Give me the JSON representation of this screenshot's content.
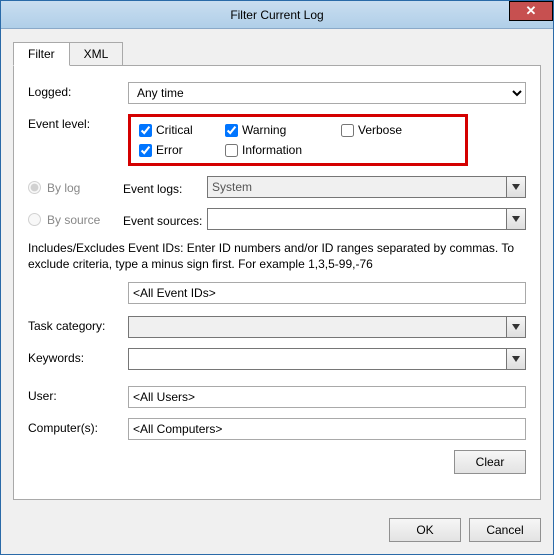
{
  "window": {
    "title": "Filter Current Log",
    "close_glyph": "✕"
  },
  "tabs": [
    {
      "label": "Filter",
      "active": true
    },
    {
      "label": "XML",
      "active": false
    }
  ],
  "labels": {
    "logged": "Logged:",
    "event_level": "Event level:",
    "by_log": "By log",
    "by_source": "By source",
    "event_logs": "Event logs:",
    "event_sources": "Event sources:",
    "task_category": "Task category:",
    "keywords": "Keywords:",
    "user": "User:",
    "computers": "Computer(s):"
  },
  "logged_value": "Any time",
  "levels": {
    "critical": {
      "label": "Critical",
      "checked": true
    },
    "warning": {
      "label": "Warning",
      "checked": true
    },
    "verbose": {
      "label": "Verbose",
      "checked": false
    },
    "error": {
      "label": "Error",
      "checked": true
    },
    "information": {
      "label": "Information",
      "checked": false
    }
  },
  "event_logs_value": "System",
  "event_sources_value": "",
  "description": "Includes/Excludes Event IDs: Enter ID numbers and/or ID ranges separated by commas. To exclude criteria, type a minus sign first. For example 1,3,5-99,-76",
  "event_ids_value": "<All Event IDs>",
  "task_category_value": "",
  "keywords_value": "",
  "user_value": "<All Users>",
  "computers_value": "<All Computers>",
  "buttons": {
    "clear": "Clear",
    "ok": "OK",
    "cancel": "Cancel"
  }
}
